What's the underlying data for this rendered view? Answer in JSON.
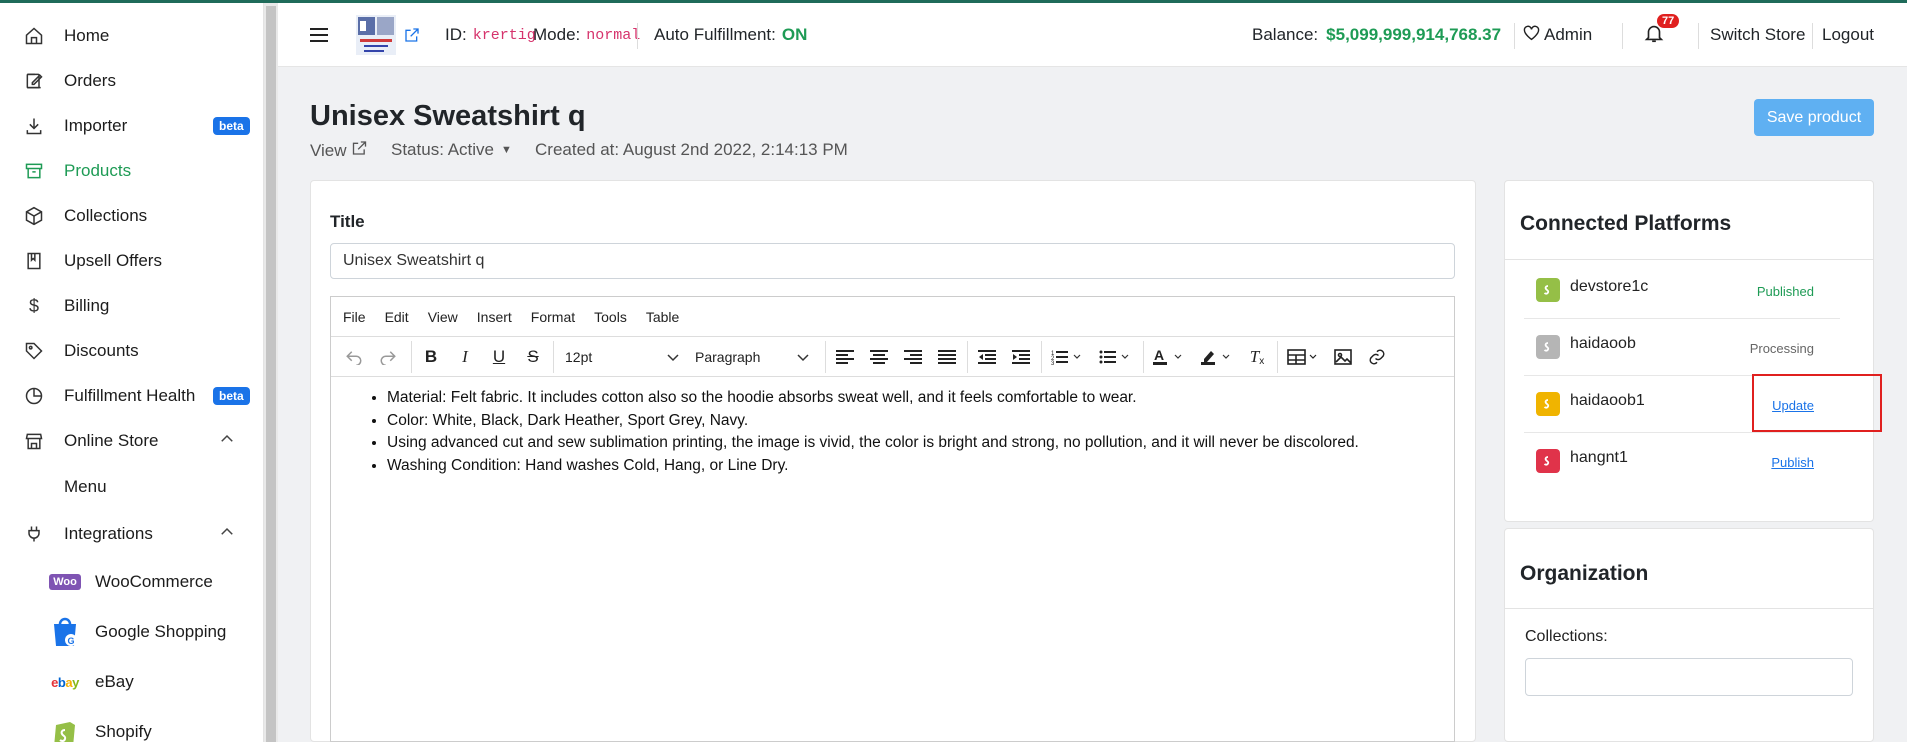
{
  "sidebar": {
    "items": [
      {
        "label": "Home",
        "icon": "home-icon"
      },
      {
        "label": "Orders",
        "icon": "edit-icon"
      },
      {
        "label": "Importer",
        "icon": "download-icon",
        "badge": "beta"
      },
      {
        "label": "Products",
        "icon": "archive-icon",
        "active": true
      },
      {
        "label": "Collections",
        "icon": "box-icon"
      },
      {
        "label": "Upsell Offers",
        "icon": "book-icon"
      },
      {
        "label": "Billing",
        "icon": "dollar-icon"
      },
      {
        "label": "Discounts",
        "icon": "tag-icon"
      },
      {
        "label": "Fulfillment Health",
        "icon": "pie-chart-icon",
        "badge": "beta"
      },
      {
        "label": "Online Store",
        "icon": "store-icon"
      },
      {
        "label": "Integrations",
        "icon": "plug-icon"
      }
    ],
    "online_store_sub": {
      "label": "Menu"
    },
    "integrations_sub": [
      {
        "label": "WooCommerce",
        "icon": "woocommerce-logo"
      },
      {
        "label": "Google Shopping",
        "icon": "google-shopping-logo"
      },
      {
        "label": "eBay",
        "icon": "ebay-logo"
      },
      {
        "label": "Shopify",
        "icon": "shopify-logo"
      }
    ],
    "badge_label": "beta"
  },
  "header": {
    "id_label": "ID:",
    "id_value": "krertig",
    "mode_label": "Mode:",
    "mode_value": "normal",
    "auto_label": "Auto Fulfillment:",
    "auto_value": "ON",
    "balance_label": "Balance:",
    "balance_value": "$5,099,999,914,768.37",
    "admin_label": "Admin",
    "notification_count": "77",
    "switch_store": "Switch Store",
    "logout": "Logout"
  },
  "page": {
    "title": "Unisex Sweatshirt q",
    "view_label": "View",
    "status_label": "Status: Active",
    "created_label": "Created at: August 2nd 2022, 2:14:13 PM",
    "save_button": "Save product"
  },
  "form": {
    "title_label": "Title",
    "title_value": "Unisex Sweatshirt q"
  },
  "editor": {
    "menu": [
      "File",
      "Edit",
      "View",
      "Insert",
      "Format",
      "Tools",
      "Table"
    ],
    "font_size": "12pt",
    "block_format": "Paragraph",
    "bullets": [
      "Material: Felt fabric. It includes cotton also so the hoodie absorbs sweat well, and it feels comfortable to wear.",
      "Color: White, Black, Dark Heather, Sport Grey, Navy.",
      "Using advanced cut and sew sublimation printing, the image is vivid, the color is bright and strong, no pollution, and it will never be discolored.",
      "Washing Condition: Hand washes Cold, Hang, or Line Dry."
    ]
  },
  "connected_platforms": {
    "title": "Connected Platforms",
    "items": [
      {
        "name": "devstore1c",
        "status": "Published",
        "color": "#95bf47"
      },
      {
        "name": "haidaoob",
        "status": "Processing",
        "color": "#b5b5b5"
      },
      {
        "name": "haidaoob1",
        "status": "Update",
        "color": "#f0b400"
      },
      {
        "name": "hangnt1",
        "status": "Publish",
        "color": "#e0334a"
      }
    ]
  },
  "organization": {
    "title": "Organization",
    "collections_label": "Collections:"
  },
  "colors": {
    "accent_green": "#1e9b55",
    "link_blue": "#1a73e8",
    "save_button_bg": "#5fb0f2"
  }
}
